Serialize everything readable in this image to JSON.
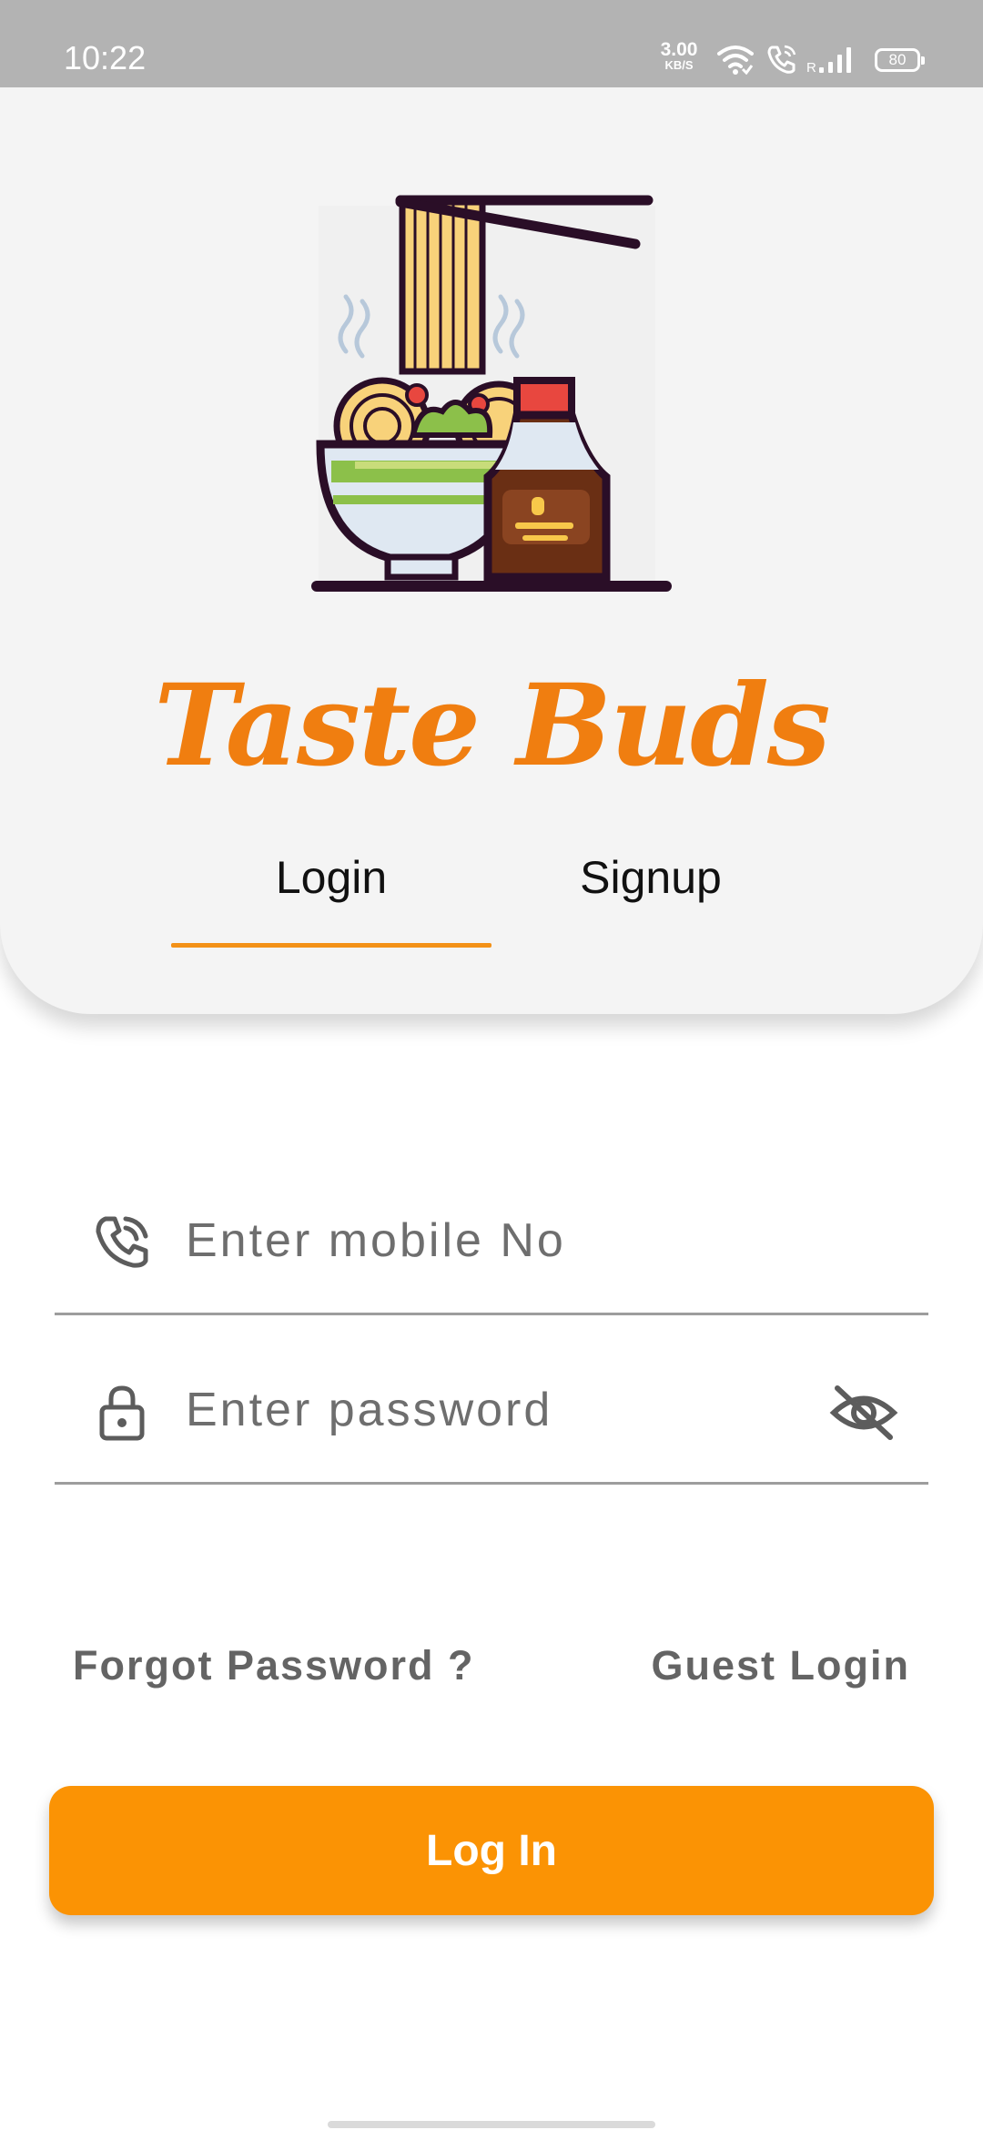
{
  "status_bar": {
    "time": "10:22",
    "network_speed_value": "3.00",
    "network_speed_unit": "KB/S",
    "roaming_indicator": "R",
    "battery_level": "80",
    "icons": [
      "wifi-icon",
      "wifi-calling-icon",
      "signal-icon",
      "battery-icon"
    ]
  },
  "header": {
    "brand_name": "Taste Buds",
    "logo_icon": "noodle-bowl-soy-sauce-icon",
    "tabs": [
      {
        "label": "Login",
        "active": true
      },
      {
        "label": "Signup",
        "active": false
      }
    ]
  },
  "form": {
    "mobile": {
      "placeholder": "Enter mobile No",
      "value": "",
      "icon": "phone-icon"
    },
    "password": {
      "placeholder": "Enter password",
      "value": "",
      "icon": "lock-icon",
      "toggle_icon": "eye-off-icon"
    }
  },
  "links": {
    "forgot_password": "Forgot Password ?",
    "guest_login": "Guest Login"
  },
  "login_button_label": "Log In",
  "colors": {
    "accent": "#fb9304",
    "brand_text": "#f07e10",
    "tab_indicator": "#f39117",
    "header_background": "#f4f4f4",
    "status_bar": "#b3b3b3"
  }
}
